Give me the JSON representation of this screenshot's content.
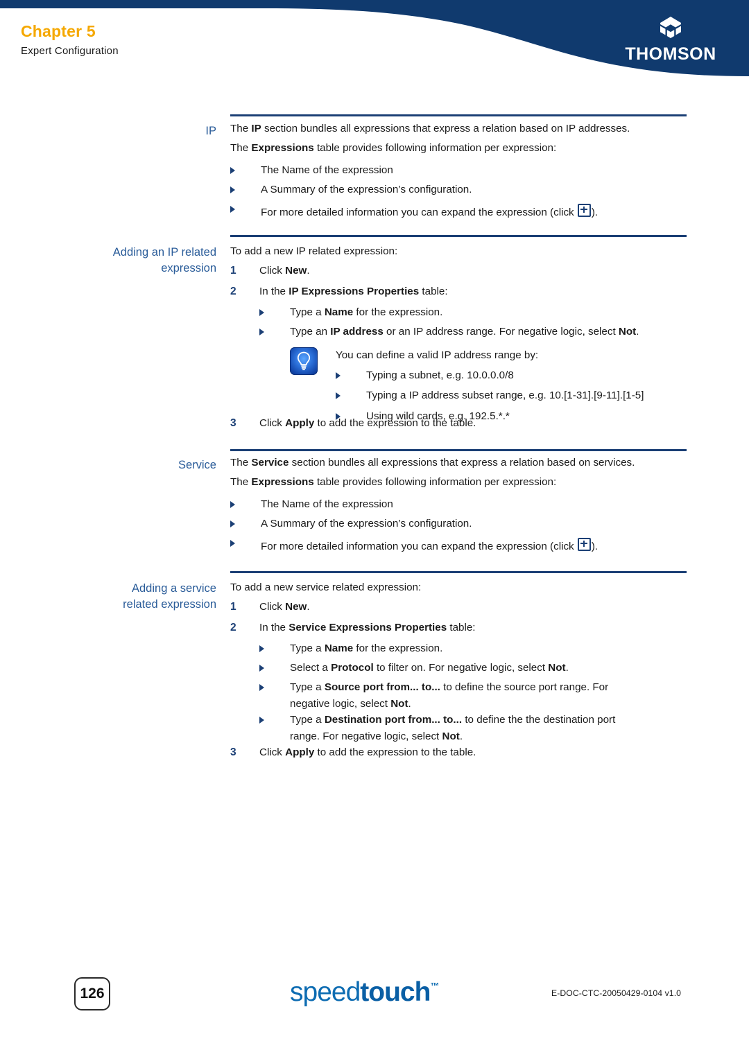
{
  "header": {
    "chapter": "Chapter 5",
    "subtitle": "Expert Configuration",
    "brand": "THOMSON",
    "brand_icon": "thomson-hexagon-logo-icon",
    "band_color": "#103a6e",
    "chapter_color": "#f5a800"
  },
  "sections": [
    {
      "id": "ip",
      "side_heading": "IP",
      "paragraphs": [
        {
          "pre": "The ",
          "bold": "IP",
          "post": " section bundles all expressions that express a relation based on IP addresses."
        },
        {
          "pre": "The ",
          "bold": "Expressions",
          "post": " table provides following information per expression:"
        }
      ],
      "bullets": [
        {
          "text": "The Name of the expression"
        },
        {
          "text": "A Summary of the expression’s configuration."
        },
        {
          "pre": "For more detailed information you can expand the expression (click ",
          "icon": "plus-icon",
          "post": ")."
        }
      ]
    },
    {
      "id": "adding-ip",
      "side_heading_line1": "Adding an IP related",
      "side_heading_line2": "expression",
      "intro": "To add a new IP related expression:",
      "steps": [
        {
          "num": "1",
          "pre": "Click ",
          "bold": "New",
          "post": "."
        },
        {
          "num": "2",
          "pre": "In the ",
          "bold": "IP Expressions Properties",
          "post": " table:"
        }
      ],
      "sub_bullets": [
        {
          "pre": "Type a ",
          "bold": "Name",
          "post": " for the expression."
        },
        {
          "pre": "Type an ",
          "bold": "IP address",
          "mid": " or an IP address range. For negative logic, select ",
          "bold2": "Not",
          "post": "."
        }
      ],
      "tip": {
        "icon": "lightbulb-tip-icon",
        "intro": "You can define a valid IP address range by:",
        "bullets": [
          "Typing a subnet, e.g. 10.0.0.0/8",
          "Typing a IP address subset range, e.g. 10.[1-31].[9-11].[1-5]",
          "Using wild cards, e.g. 192.5.*.*"
        ]
      },
      "final_step": {
        "num": "3",
        "pre": "Click ",
        "bold": "Apply",
        "post": " to add the expression to the table."
      }
    },
    {
      "id": "service",
      "side_heading": "Service",
      "paragraphs": [
        {
          "pre": "The ",
          "bold": "Service",
          "post": " section bundles all expressions that express a relation based on services."
        },
        {
          "pre": "The ",
          "bold": "Expressions",
          "post": " table provides following information per expression:"
        }
      ],
      "bullets": [
        {
          "text": "The Name of the expression"
        },
        {
          "text": "A Summary of the expression’s configuration."
        },
        {
          "pre": "For more detailed information you can expand the expression (click ",
          "icon": "plus-icon",
          "post": ")."
        }
      ]
    },
    {
      "id": "adding-service",
      "side_heading_line1": "Adding a service",
      "side_heading_line2": "related expression",
      "intro": "To add a new service related expression:",
      "steps": [
        {
          "num": "1",
          "pre": "Click ",
          "bold": "New",
          "post": "."
        },
        {
          "num": "2",
          "pre": "In the ",
          "bold": "Service Expressions Properties",
          "post": " table:"
        }
      ],
      "sub_bullets": [
        {
          "pre": "Type a ",
          "bold": "Name",
          "post": " for the expression."
        },
        {
          "pre": "Select a ",
          "bold": "Protocol",
          "mid": " to filter on. For negative logic, select ",
          "bold2": "Not",
          "post": "."
        },
        {
          "pre": "Type a ",
          "bold": "Source port from... to...",
          "mid": " to define the source port range. For",
          "line2_pre": "negative logic, select ",
          "bold2": "Not",
          "post": "."
        },
        {
          "pre": "Type a ",
          "bold": "Destination port from... to...",
          "mid": " to define the the destination port",
          "line2_pre": "range. For negative logic, select ",
          "bold2": "Not",
          "post": "."
        }
      ],
      "final_step": {
        "num": "3",
        "pre": "Click ",
        "bold": "Apply",
        "post": " to add the expression to the table."
      }
    }
  ],
  "footer": {
    "page_number": "126",
    "logo_light": "speed",
    "logo_bold": "touch",
    "logo_tm": "™",
    "doc_code": "E-DOC-CTC-20050429-0104 v1.0"
  }
}
